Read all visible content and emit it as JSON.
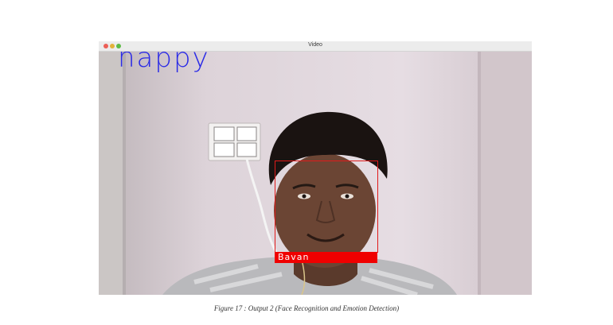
{
  "window": {
    "title": "Video"
  },
  "detection": {
    "emotion": "happy",
    "name": "Bavan"
  },
  "caption": "Figure 17 : Output 2  (Face Recognition and Emotion Detection)",
  "colors": {
    "emotion_text": "#2a2ae6",
    "face_box": "#e01a1a",
    "name_bar": "#f00000"
  }
}
